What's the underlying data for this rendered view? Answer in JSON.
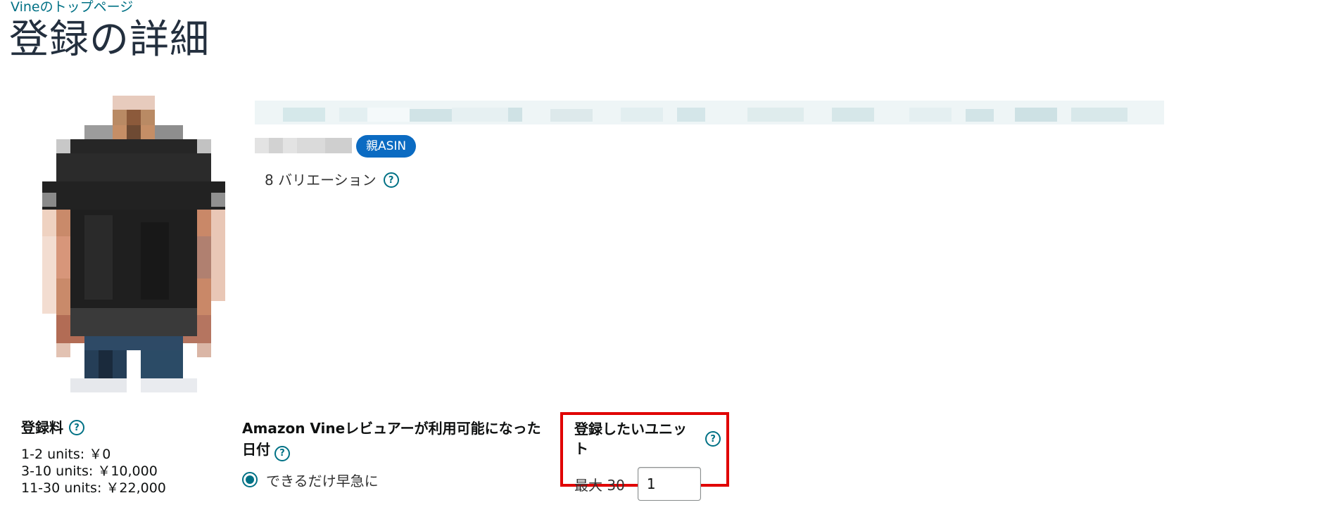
{
  "header": {
    "breadcrumb": "Vineのトップページ",
    "title": "登録の詳細"
  },
  "product": {
    "badge": "親ASIN",
    "variations": "8 バリエーション"
  },
  "fees": {
    "label": "登録料",
    "rows": [
      "1-2 units: ￥0",
      "3-10 units: ￥10,000",
      "11-30 units: ￥22,000"
    ]
  },
  "availability": {
    "label": "Amazon Vineレビュアーが利用可能になった日付",
    "option": "できるだけ早急に"
  },
  "units": {
    "label": "登録したいユニット",
    "max_label": "最大 30",
    "value": "1"
  },
  "colors": {
    "link": "#007185",
    "badge": "#0b6bc2",
    "highlight": "#e00000"
  }
}
